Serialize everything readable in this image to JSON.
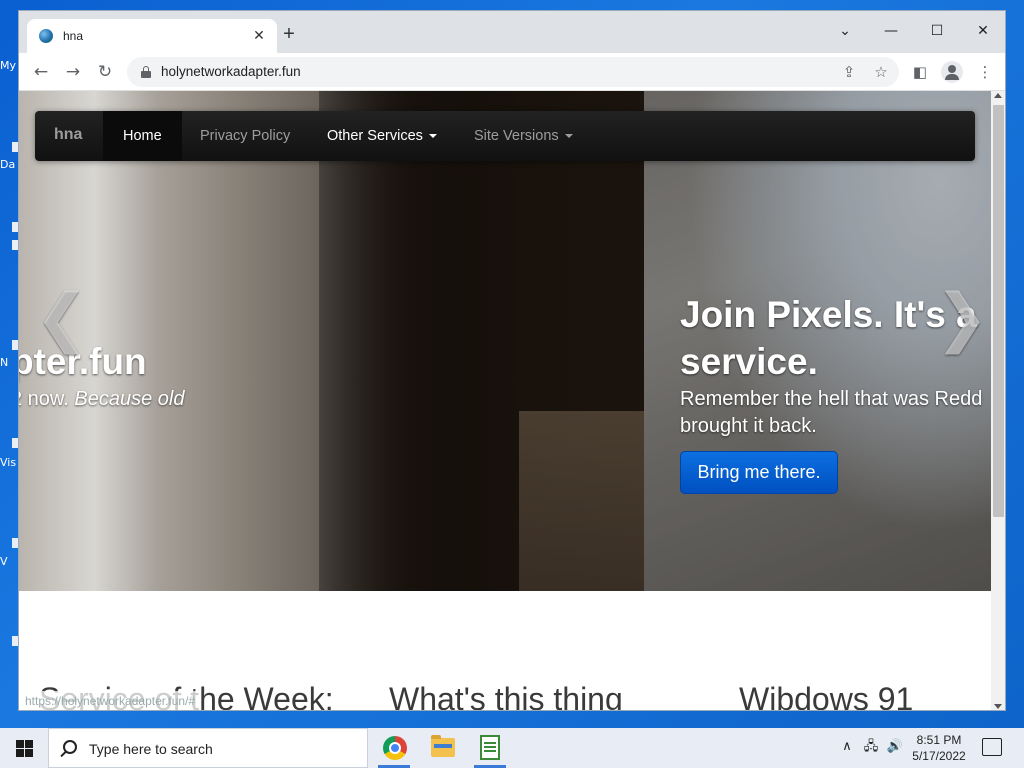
{
  "desktop": {
    "fragments": [
      "My",
      "Da",
      "N",
      "Vis",
      "V"
    ]
  },
  "browser": {
    "tab_title": "hna",
    "tab_close": "✕",
    "new_tab": "+",
    "window_controls": {
      "tab_search": "⌄",
      "minimize": "—",
      "maximize": "☐",
      "close": "✕"
    },
    "nav": {
      "back": "←",
      "forward": "→",
      "reload": "↻"
    },
    "url": "holynetworkadapter.fun",
    "omnibox_icons": [
      "share-icon",
      "star-icon"
    ],
    "toolbar_icons": [
      "side-panel-icon",
      "profile-icon",
      "menu-icon"
    ],
    "menu_glyph": "⋮",
    "share_glyph": "⇪",
    "star_glyph": "☆",
    "side_panel_glyph": "◧"
  },
  "site": {
    "brand": "hna",
    "nav_items": [
      "Home",
      "Privacy Policy",
      "Other Services",
      "Site Versions"
    ],
    "slide_left": {
      "heading": "pter.fun",
      "sub_plain": "2 now. ",
      "sub_italic": "Because old"
    },
    "slide_right": {
      "heading_line1": "Join Pixels. It's a",
      "heading_line2": "service.",
      "sub_line1": "Remember the hell that was Redd",
      "sub_line2": "brought it back.",
      "button": "Bring me there."
    },
    "arrows": {
      "prev": "❮",
      "next": "❯"
    },
    "sections": [
      "Service of the Week:",
      "What's this thing",
      "Wibdows 91"
    ],
    "status_url": "https://holynetworkadapter.fun/#"
  },
  "taskbar": {
    "search_placeholder": "Type here to search",
    "apps": [
      "chrome-icon",
      "file-explorer-icon",
      "notepad-icon"
    ],
    "tray": {
      "chevron": "∧",
      "network": "🖧",
      "volume": "🔊"
    },
    "time": "8:51 PM",
    "date": "5/17/2022"
  }
}
